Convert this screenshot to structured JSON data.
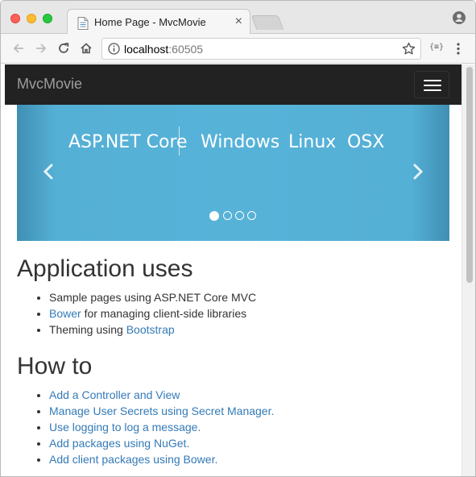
{
  "browser": {
    "tab_title": "Home Page - MvcMovie",
    "tab_close": "×",
    "url_host": "localhost",
    "url_port": ":60505",
    "ext_label": "{≡}"
  },
  "app": {
    "brand": "MvcMovie"
  },
  "carousel": {
    "items": [
      "ASP.NET Core",
      "Windows",
      "Linux",
      "OSX"
    ],
    "active_indicator": 1,
    "indicator_count": 4
  },
  "sections": {
    "uses_heading": "Application uses",
    "uses_item1": "Sample pages using ASP.NET Core MVC",
    "uses_item2_link": "Bower",
    "uses_item2_rest": " for managing client-side libraries",
    "uses_item3_text": "Theming using ",
    "uses_item3_link": "Bootstrap",
    "howto_heading": "How to",
    "howto_links": [
      "Add a Controller and View",
      "Manage User Secrets using Secret Manager.",
      "Use logging to log a message.",
      "Add packages using NuGet.",
      "Add client packages using Bower."
    ]
  },
  "colors": {
    "navbar": "#222222",
    "link": "#337ab7",
    "carousel": "#57b2d8"
  }
}
